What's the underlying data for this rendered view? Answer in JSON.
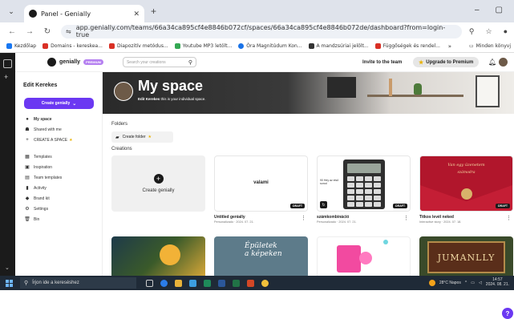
{
  "browser": {
    "tab": {
      "title": "Panel - Genially",
      "close": "✕"
    },
    "url": "app.genially.com/teams/66a34ca895cf4e8846b072cf/spaces/66a34ca895cf4e8846b072de/dashboard?from=login-true",
    "bookmarks": [
      {
        "label": "Kezdőlap",
        "color": "#1877f2"
      },
      {
        "label": "Domains - kereskea...",
        "color": "#d93025"
      },
      {
        "label": "Diapozitív metódus...",
        "color": "#d93025"
      },
      {
        "label": "Youtube MP3 letölt...",
        "color": "#34a853"
      },
      {
        "label": "Óra Magnitúdum Kon...",
        "color": "#1a73e8"
      },
      {
        "label": "A mandzsúriai jelölt...",
        "color": "#333333"
      },
      {
        "label": "Függőségek és rendel...",
        "color": "#d93025"
      }
    ],
    "bookmarks_more": "»",
    "bookmarks_folder": "Minden könyvj"
  },
  "header": {
    "logo": "genially",
    "logo_badge": "PREMIUM",
    "search_placeholder": "Search your creations",
    "invite": "Invite to the team",
    "upgrade": "Upgrade to Premium"
  },
  "sidebar": {
    "title": "Edit Kerekes",
    "create_button": "Create genially",
    "items": [
      {
        "icon": "●",
        "label": "My space",
        "active": true
      },
      {
        "icon": "☗",
        "label": "Shared with me"
      },
      {
        "icon": "+",
        "label": "CREATE A SPACE",
        "star": true
      },
      {
        "icon": "▦",
        "label": "Templates"
      },
      {
        "icon": "▣",
        "label": "Inspiration"
      },
      {
        "icon": "▤",
        "label": "Team templates"
      },
      {
        "icon": "▮",
        "label": "Activity"
      },
      {
        "icon": "◆",
        "label": "Brand kit"
      },
      {
        "icon": "⚙",
        "label": "Settings"
      },
      {
        "icon": "🗑",
        "label": "Bin"
      }
    ]
  },
  "main": {
    "hero_title": "My space",
    "hero_sub_name": "Edit Kerekes",
    "hero_sub_rest": " this is your individual space.",
    "folders_heading": "Folders",
    "create_folder": "Create folder",
    "creations_heading": "Creations",
    "create_genially": "Create genially",
    "cards": [
      {
        "thumb_text": "valami",
        "title": "Untitled genially",
        "sub": "Personalizado · 2024. 07. 21.",
        "draft": "DRAFT"
      },
      {
        "thumb_text": "90 Hey az első sorod",
        "title": "számkombináció",
        "sub": "Personalizado · 2024. 07. 21.",
        "draft": "DRAFT"
      },
      {
        "thumb_text_1": "Van egy üzenetem",
        "thumb_text_2": "számodra",
        "title": "Titkos levél neked",
        "sub": "Interactive story · 2024. 07. 18.",
        "draft": "DRAFT"
      }
    ],
    "row2": [
      {
        "text": ""
      },
      {
        "text_1": "Épületek",
        "text_2": "a képeken"
      },
      {
        "text": ""
      },
      {
        "text": "JUMANLLY"
      }
    ]
  },
  "taskbar": {
    "search": "Írjon ide a kereséshez",
    "weather": "28°C Napos",
    "time": "14:57",
    "date": "2024. 08. 21."
  }
}
